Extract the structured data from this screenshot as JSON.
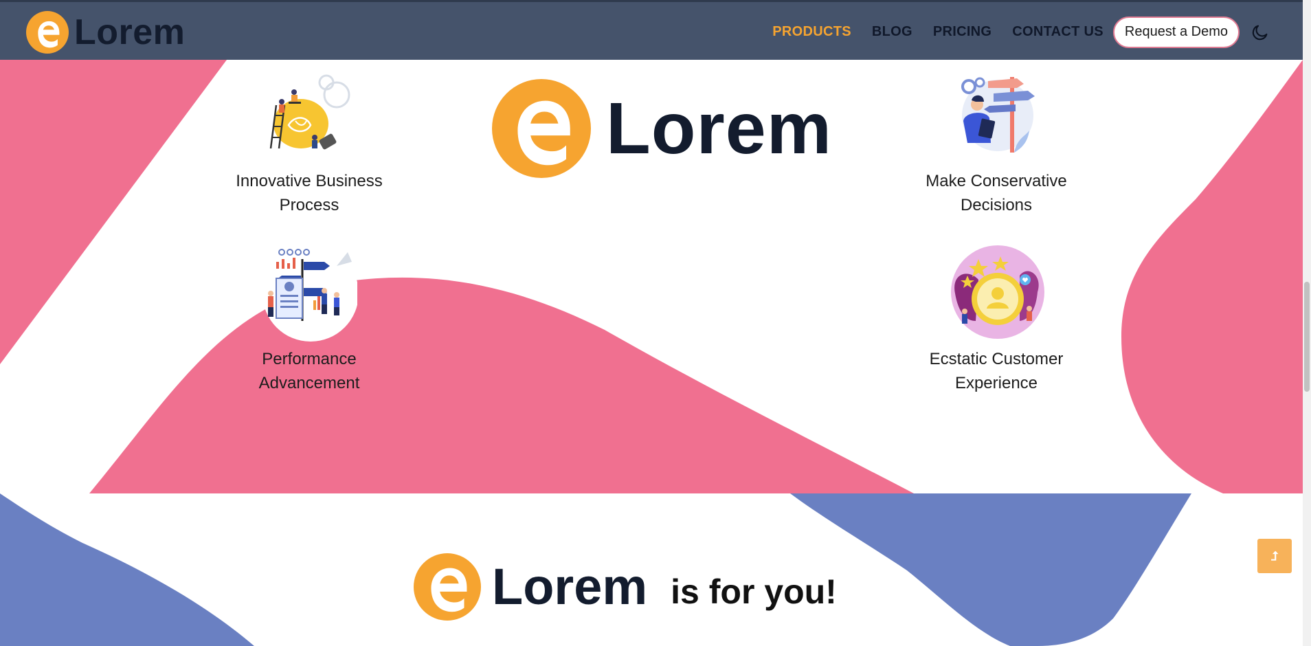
{
  "brand": {
    "name": "Lorem",
    "accent_color": "#f6a430",
    "dark_color": "#131c2e"
  },
  "header": {
    "background": "#45536b",
    "nav": [
      {
        "label": "PRODUCTS",
        "active": true
      },
      {
        "label": "BLOG",
        "active": false
      },
      {
        "label": "PRICING",
        "active": false
      },
      {
        "label": "CONTACT US",
        "active": false
      }
    ],
    "cta_label": "Request a Demo",
    "theme_toggle_icon": "moon-icon"
  },
  "hero": {
    "logo_text": "Lorem",
    "pink_color": "#f07090"
  },
  "features": [
    {
      "title": "Innovative Business Process",
      "icon": "lightbulb-illustration"
    },
    {
      "title": "Make Conservative Decisions",
      "icon": "signpost-illustration"
    },
    {
      "title": "Performance Advancement",
      "icon": "analytics-illustration"
    },
    {
      "title": "Ecstatic Customer Experience",
      "icon": "customer-rating-illustration"
    }
  ],
  "bottom": {
    "logo_text": "Lorem",
    "tagline": "is for you!",
    "blue_color": "#6a80c2"
  },
  "back_to_top": {
    "icon": "arrow-up-icon",
    "glyph": "⮥"
  }
}
